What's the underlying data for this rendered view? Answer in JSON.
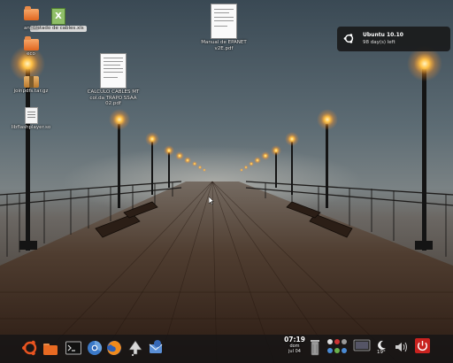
{
  "desktop_icons": [
    {
      "label": "",
      "kind": "folder",
      "name": "folder-icon-top"
    },
    {
      "label": "Listado de cables.xls",
      "kind": "xls",
      "name": "spreadsheet-icon"
    },
    {
      "label": "anexo",
      "kind": "folder",
      "name": "folder-icon-anexo"
    },
    {
      "label": "eco",
      "kind": "folder",
      "name": "folder-icon-eco"
    },
    {
      "label": "joinpdfs.tar.gz",
      "kind": "archive",
      "name": "archive-icon"
    },
    {
      "label": "libflashplayer.so",
      "kind": "file",
      "name": "file-icon"
    },
    {
      "label": "Manual de EPANET v2E.pdf",
      "kind": "pdf",
      "name": "pdf-icon-epanet"
    },
    {
      "label": "CALCULO CABLES MT col.da TRAPO SSAA 02.pdf",
      "kind": "pdf",
      "name": "pdf-icon-calculo"
    }
  ],
  "notification": {
    "title": "Ubuntu 10.10",
    "body": "98 day(s)  left",
    "icon": "ubuntu-logo-icon"
  },
  "panel": {
    "launchers": [
      {
        "name": "ubuntu-menu-icon"
      },
      {
        "name": "folder-launcher-icon"
      },
      {
        "name": "terminal-icon"
      },
      {
        "name": "chromium-icon"
      },
      {
        "name": "firefox-icon"
      },
      {
        "name": "inkscape-icon"
      },
      {
        "name": "thunderbird-icon"
      }
    ],
    "clock": {
      "time": "07:19",
      "day": "dom",
      "date": "jul 04"
    },
    "tray": [
      "trash-icon",
      "network-icon",
      "indicator-icons",
      "display-icon",
      "weather-icon",
      "volume-icon",
      "power-icon"
    ],
    "weather_temp": "19°"
  },
  "colors": {
    "accent": "#e95420",
    "panel_bg": "#1d1f22",
    "power": "#c8221f"
  }
}
